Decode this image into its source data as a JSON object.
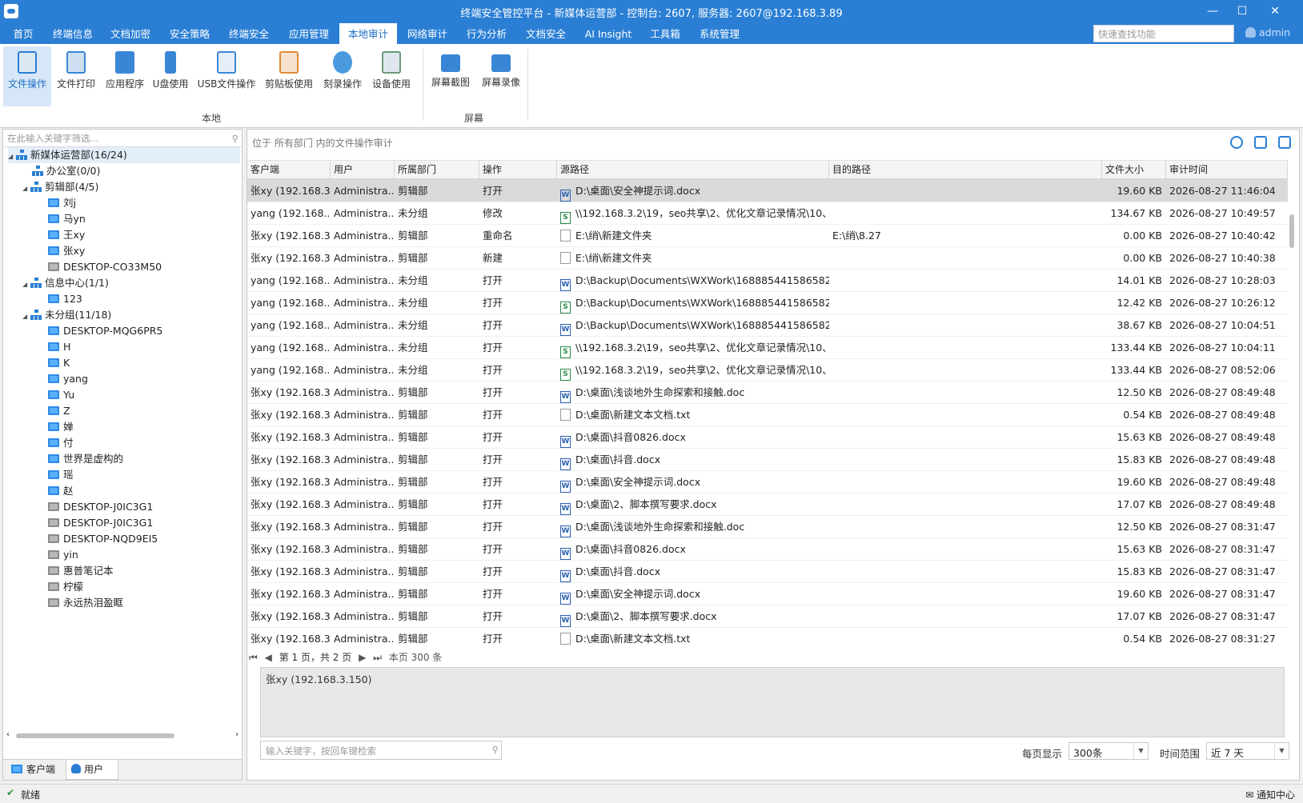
{
  "window": {
    "title": "终端安全管控平台 - 新媒体运营部 - 控制台: 2607, 服务器: 2607@192.168.3.89"
  },
  "menu": [
    "首页",
    "终端信息",
    "文档加密",
    "安全策略",
    "终端安全",
    "应用管理",
    "本地审计",
    "网络审计",
    "行为分析",
    "文档安全",
    "AI Insight",
    "工具箱",
    "系统管理"
  ],
  "quick_search": {
    "placeholder": "快速查找功能"
  },
  "user": {
    "name": "admin"
  },
  "ribbon": {
    "local": [
      "文件操作",
      "文件打印",
      "应用程序",
      "U盘使用",
      "USB文件操作",
      "剪贴板使用",
      "刻录操作",
      "设备使用"
    ],
    "local_group": "本地",
    "screen": [
      "屏幕截图",
      "屏幕录像"
    ],
    "screen_group": "屏幕"
  },
  "tree": {
    "search_placeholder": "在此输入关键字筛选...",
    "nodes": [
      "新媒体运营部(16/24)",
      "办公室(0/0)",
      "剪辑部(4/5)",
      "刘j",
      "马yn",
      "王xy",
      "张xy",
      "DESKTOP-CO33M50",
      "信息中心(1/1)",
      "123",
      "未分组(11/18)",
      "DESKTOP-MQG6PR5",
      "H",
      "K",
      "yang",
      "Yu",
      "Z",
      "婵",
      "付",
      "世界是虚构的",
      "瑶",
      "赵",
      "DESKTOP-J0IC3G1",
      "DESKTOP-J0IC3G1",
      "DESKTOP-NQD9EI5",
      "yin",
      "惠普笔记本",
      "柠檬",
      "永远热泪盈眶"
    ],
    "tabs": [
      "客户端",
      "用户"
    ]
  },
  "main": {
    "breadcrumb": "位于 所有部门 内的文件操作审计",
    "columns": [
      "客户端",
      "用户",
      "所属部门",
      "操作",
      "源路径",
      "目的路径",
      "文件大小",
      "审计时间"
    ],
    "rows": [
      [
        "张xy (192.168.3...",
        "Administra...",
        "剪辑部",
        "打开",
        "D:\\桌面\\安全神提示词.docx",
        "",
        "19.60 KB",
        "2026-08-27 11:46:04"
      ],
      [
        "yang (192.168....",
        "Administra...",
        "未分组",
        "修改",
        "\\\\192.168.3.2\\19，seo共享\\2、优化文章记录情况\\10、...",
        "",
        "134.67 KB",
        "2026-08-27 10:49:57"
      ],
      [
        "张xy (192.168.3...",
        "Administra...",
        "剪辑部",
        "重命名",
        "E:\\绡\\新建文件夹",
        "E:\\绡\\8.27",
        "0.00 KB",
        "2026-08-27 10:40:42"
      ],
      [
        "张xy (192.168.3...",
        "Administra...",
        "剪辑部",
        "新建",
        "E:\\绡\\新建文件夹",
        "",
        "0.00 KB",
        "2026-08-27 10:40:38"
      ],
      [
        "yang (192.168....",
        "Administra...",
        "未分组",
        "打开",
        "D:\\Backup\\Documents\\WXWork\\168885441586582...",
        "",
        "14.01 KB",
        "2026-08-27 10:28:03"
      ],
      [
        "yang (192.168....",
        "Administra...",
        "未分组",
        "打开",
        "D:\\Backup\\Documents\\WXWork\\168885441586582...",
        "",
        "12.42 KB",
        "2026-08-27 10:26:12"
      ],
      [
        "yang (192.168....",
        "Administra...",
        "未分组",
        "打开",
        "D:\\Backup\\Documents\\WXWork\\168885441586582...",
        "",
        "38.67 KB",
        "2026-08-27 10:04:51"
      ],
      [
        "yang (192.168....",
        "Administra...",
        "未分组",
        "打开",
        "\\\\192.168.3.2\\19，seo共享\\2、优化文章记录情况\\10、...",
        "",
        "133.44 KB",
        "2026-08-27 10:04:11"
      ],
      [
        "yang (192.168....",
        "Administra...",
        "未分组",
        "打开",
        "\\\\192.168.3.2\\19，seo共享\\2、优化文章记录情况\\10、...",
        "",
        "133.44 KB",
        "2026-08-27 08:52:06"
      ],
      [
        "张xy (192.168.3...",
        "Administra...",
        "剪辑部",
        "打开",
        "D:\\桌面\\浅谈地外生命探索和接触.doc",
        "",
        "12.50 KB",
        "2026-08-27 08:49:48"
      ],
      [
        "张xy (192.168.3...",
        "Administra...",
        "剪辑部",
        "打开",
        "D:\\桌面\\新建文本文档.txt",
        "",
        "0.54 KB",
        "2026-08-27 08:49:48"
      ],
      [
        "张xy (192.168.3...",
        "Administra...",
        "剪辑部",
        "打开",
        "D:\\桌面\\抖音0826.docx",
        "",
        "15.63 KB",
        "2026-08-27 08:49:48"
      ],
      [
        "张xy (192.168.3...",
        "Administra...",
        "剪辑部",
        "打开",
        "D:\\桌面\\抖音.docx",
        "",
        "15.83 KB",
        "2026-08-27 08:49:48"
      ],
      [
        "张xy (192.168.3...",
        "Administra...",
        "剪辑部",
        "打开",
        "D:\\桌面\\安全神提示词.docx",
        "",
        "19.60 KB",
        "2026-08-27 08:49:48"
      ],
      [
        "张xy (192.168.3...",
        "Administra...",
        "剪辑部",
        "打开",
        "D:\\桌面\\2、脚本撰写要求.docx",
        "",
        "17.07 KB",
        "2026-08-27 08:49:48"
      ],
      [
        "张xy (192.168.3...",
        "Administra...",
        "剪辑部",
        "打开",
        "D:\\桌面\\浅谈地外生命探索和接触.doc",
        "",
        "12.50 KB",
        "2026-08-27 08:31:47"
      ],
      [
        "张xy (192.168.3...",
        "Administra...",
        "剪辑部",
        "打开",
        "D:\\桌面\\抖音0826.docx",
        "",
        "15.63 KB",
        "2026-08-27 08:31:47"
      ],
      [
        "张xy (192.168.3...",
        "Administra...",
        "剪辑部",
        "打开",
        "D:\\桌面\\抖音.docx",
        "",
        "15.83 KB",
        "2026-08-27 08:31:47"
      ],
      [
        "张xy (192.168.3...",
        "Administra...",
        "剪辑部",
        "打开",
        "D:\\桌面\\安全神提示词.docx",
        "",
        "19.60 KB",
        "2026-08-27 08:31:47"
      ],
      [
        "张xy (192.168.3...",
        "Administra...",
        "剪辑部",
        "打开",
        "D:\\桌面\\2、脚本撰写要求.docx",
        "",
        "17.07 KB",
        "2026-08-27 08:31:47"
      ],
      [
        "张xy (192.168.3...",
        "Administra...",
        "剪辑部",
        "打开",
        "D:\\桌面\\新建文本文档.txt",
        "",
        "0.54 KB",
        "2026-08-27 08:31:27"
      ]
    ],
    "file_icons": [
      "word",
      "excel",
      "folder",
      "folder",
      "word",
      "excel",
      "word",
      "excel",
      "excel",
      "word",
      "text",
      "word",
      "word",
      "word",
      "word",
      "word",
      "word",
      "word",
      "word",
      "word",
      "text"
    ],
    "pager": {
      "text": "第 1 页，共 2 页",
      "count": "本页 300 条"
    },
    "detail_text": "张xy (192.168.3.150)",
    "bottom": {
      "search_placeholder": "输入关键字，按回车键检索",
      "per_page_label": "每页显示",
      "per_page": "300条",
      "range_label": "时间范围",
      "range": "近 7 天"
    }
  },
  "status": {
    "text": "就绪",
    "notify": "通知中心"
  },
  "colors": {
    "accent": "#2a7fd4",
    "selected_row": "#d9d9d9"
  }
}
